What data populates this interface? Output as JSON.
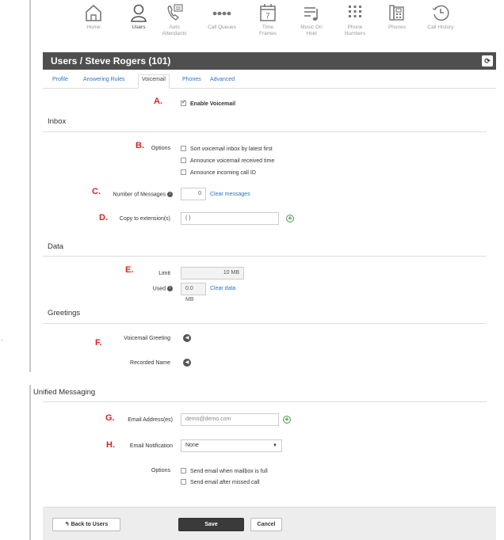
{
  "nav": {
    "items": [
      {
        "label": "Home",
        "icon": "home-icon"
      },
      {
        "label": "Users",
        "icon": "user-icon"
      },
      {
        "label": "Auto\nAttendants",
        "icon": "phone-menu-icon"
      },
      {
        "label": "Call Queues",
        "icon": "queue-dots-icon"
      },
      {
        "label": "Time\nFrames",
        "icon": "calendar-icon"
      },
      {
        "label": "Music On\nHold",
        "icon": "music-icon"
      },
      {
        "label": "Phone\nNumbers",
        "icon": "dialpad-icon"
      },
      {
        "label": "Phones",
        "icon": "desk-phone-icon"
      },
      {
        "label": "Call History",
        "icon": "history-icon"
      }
    ],
    "calendar_day": "7"
  },
  "header": {
    "title": "Users / Steve Rogers (101)",
    "refresh_icon": "⟳"
  },
  "tabs": [
    "Profile",
    "Answering Rules",
    "Voicemail",
    "Phones",
    "Advanced"
  ],
  "markers": {
    "a": "A.",
    "b": "B.",
    "c": "C.",
    "d": "D.",
    "e": "E.",
    "f": "F.",
    "g": "G.",
    "h": "H."
  },
  "voicemail": {
    "enable_label": "Enable Voicemail"
  },
  "inbox": {
    "title": "Inbox",
    "options_label": "Options",
    "options": [
      "Sort voicemail inbox by latest first",
      "Announce voicemail received time",
      "Announce incoming call ID"
    ],
    "num_messages_label": "Number of Messages",
    "num_messages_value": "0",
    "clear_messages": "Clear messages",
    "copy_label": "Copy to extension(s)",
    "copy_value": "( )"
  },
  "data": {
    "title": "Data",
    "limit_label": "Limit",
    "limit_value": "10 MB",
    "used_label": "Used",
    "used_value": "0.0 MB",
    "clear_data": "Clear data"
  },
  "greetings": {
    "title": "Greetings",
    "voicemail_greeting": "Voicemail Greeting",
    "recorded_name": "Recorded Name"
  },
  "unified": {
    "title": "Unified Messaging",
    "email_label": "Email Address(es)",
    "email_value": "demo@demo.com",
    "notification_label": "Email Notification",
    "notification_value": "None",
    "options_label": "Options",
    "options": [
      "Send email when mailbox is full",
      "Send email after missed call"
    ]
  },
  "footer": {
    "back": "Back to Users",
    "back_icon": "↰",
    "save": "Save",
    "cancel": "Cancel"
  },
  "page_edge_mark": "-"
}
